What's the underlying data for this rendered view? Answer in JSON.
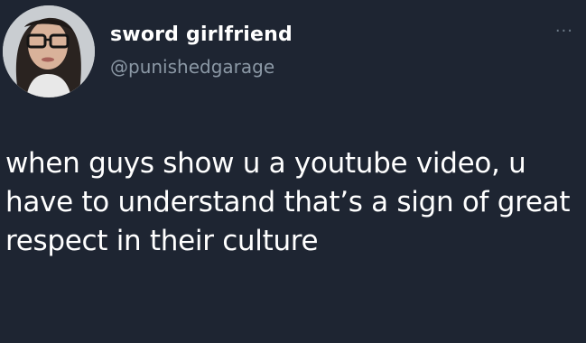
{
  "author": {
    "display_name": "sword girlfriend",
    "handle": "@punishedgarage",
    "avatar_icon": "profile-photo"
  },
  "menu": {
    "icon": "more-options-icon",
    "glyph": "···"
  },
  "tweet": {
    "text": "when guys show u a youtube video, u have to understand that’s a sign of great respect in their culture"
  },
  "colors": {
    "background": "#1e2532",
    "name": "#ffffff",
    "handle": "#8b98a5",
    "text": "#ffffff"
  }
}
